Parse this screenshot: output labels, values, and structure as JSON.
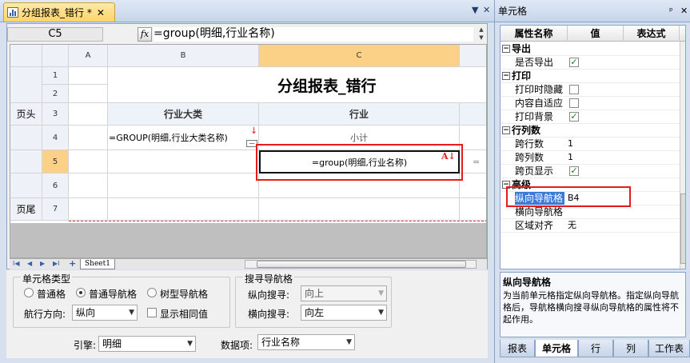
{
  "editor": {
    "tab_title": "分组报表_错行 *",
    "tab_close": "✕",
    "window_controls": [
      "▼",
      "✕"
    ],
    "cell_ref": "C5",
    "fx_label": "fx",
    "formula": "=group(明细,行业名称)",
    "columns": [
      "A",
      "B",
      "C"
    ],
    "rows": [
      "1",
      "2",
      "3",
      "4",
      "5",
      "6",
      "7"
    ],
    "row_labels": {
      "r3": "页头",
      "r7": "页尾"
    },
    "cells": {
      "title": "分组报表_错行",
      "b3": "行业大类",
      "c3": "行业",
      "b4": "=GROUP(明细,行业大类名称)",
      "c4": "小计",
      "c5": "=group(明细,行业名称)",
      "c5_marker": "A↓",
      "b4_marker": "↓",
      "d5_edge": "="
    },
    "sheet_tab": "Sheet1",
    "sheet_nav": [
      "I◀",
      "◀",
      "▶",
      "▶I",
      "+"
    ]
  },
  "cell_type_panel": {
    "group_title": "单元格类型",
    "options": [
      {
        "label": "普通格",
        "selected": false
      },
      {
        "label": "普通导航格",
        "selected": true
      },
      {
        "label": "树型导航格",
        "selected": false
      }
    ],
    "direction_label": "航行方向:",
    "direction_value": "纵向",
    "show_same_label": "显示相同值",
    "show_same_checked": false
  },
  "search_panel": {
    "group_title": "搜寻导航格",
    "vertical_label": "纵向搜寻:",
    "vertical_value": "向上",
    "horizontal_label": "横向搜寻:",
    "horizontal_value": "向左"
  },
  "engine": {
    "label": "引擎:",
    "value": "明细"
  },
  "data_item": {
    "label": "数据项:",
    "value": "行业名称"
  },
  "properties": {
    "panel_title": "单元格",
    "panel_controls": [
      "ᵖ",
      "✕"
    ],
    "columns": [
      "属性名称",
      "值",
      "表达式"
    ],
    "groups": [
      {
        "title": "导出",
        "items": [
          {
            "name": "是否导出",
            "type": "check",
            "checked": true
          }
        ]
      },
      {
        "title": "打印",
        "items": [
          {
            "name": "打印时隐藏",
            "type": "check",
            "checked": false
          },
          {
            "name": "内容自适应",
            "type": "check",
            "checked": false
          },
          {
            "name": "打印背景",
            "type": "check",
            "checked": true
          }
        ]
      },
      {
        "title": "行列数",
        "items": [
          {
            "name": "跨行数",
            "type": "text",
            "value": "1"
          },
          {
            "name": "跨列数",
            "type": "text",
            "value": "1"
          },
          {
            "name": "跨页显示",
            "type": "check",
            "checked": true
          }
        ]
      },
      {
        "title": "高级",
        "items": [
          {
            "name": "纵向导航格",
            "type": "text",
            "value": "B4",
            "selected": true
          },
          {
            "name": "横向导航格",
            "type": "text",
            "value": ""
          },
          {
            "name": "区域对齐",
            "type": "text",
            "value": "无"
          }
        ]
      }
    ],
    "description_title": "纵向导航格",
    "description_text": "为当前单元格指定纵向导航格。指定纵向导航格后，导航格横向搜寻纵向导航格的属性将不起作用。",
    "tabs": [
      {
        "label": "报表",
        "active": false
      },
      {
        "label": "单元格",
        "active": true
      },
      {
        "label": "行",
        "active": false
      },
      {
        "label": "列",
        "active": false
      },
      {
        "label": "工作表",
        "active": false
      }
    ]
  },
  "colors": {
    "highlight": "#fbd188",
    "accent_red": "#e81b1b",
    "selected_prop": "#3a7bd5"
  }
}
